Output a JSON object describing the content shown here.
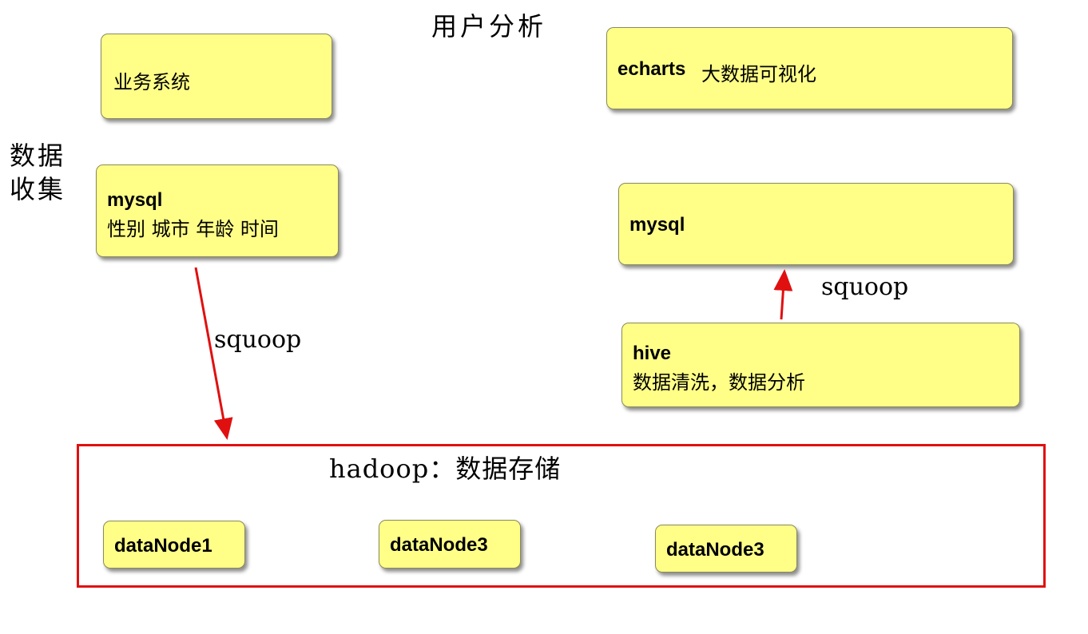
{
  "title": "用户分析",
  "side_label": {
    "line1": "数据",
    "line2": "收集"
  },
  "boxes": {
    "business_system": {
      "text": "业务系统"
    },
    "mysql_source": {
      "title": "mysql",
      "fields": "性别 城市 年龄 时间"
    },
    "echarts": {
      "title": "echarts",
      "text": "大数据可视化"
    },
    "mysql_target": {
      "title": "mysql"
    },
    "hive": {
      "title": "hive",
      "text": "数据清洗，数据分析"
    }
  },
  "edges": {
    "left_label": "squoop",
    "right_label": "squoop"
  },
  "storage": {
    "label": "hadoop：数据存储",
    "nodes": [
      "dataNode1",
      "dataNode3",
      "dataNode3"
    ]
  },
  "colors": {
    "note_fill": "#ffff88",
    "arrow": "#e01010",
    "frame": "#e01010"
  }
}
